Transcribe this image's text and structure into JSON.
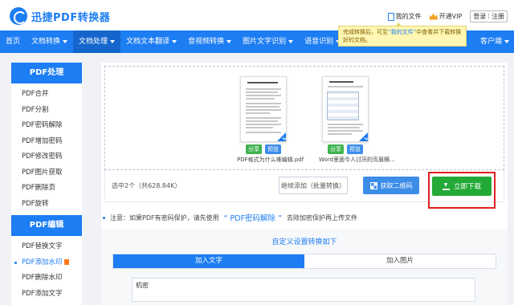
{
  "header": {
    "logo_text": "迅捷PDF转换器",
    "my_files": "我的文件",
    "vip": "开通VIP",
    "login": "登录",
    "register": "注册"
  },
  "tooltip": {
    "text_before": "完成转换后，可至",
    "highlight": "“我的文件”",
    "text_after": "中查看并下载转换好的文档。"
  },
  "nav": {
    "items": [
      {
        "label": "首页",
        "caret": false,
        "active": false
      },
      {
        "label": "文档转换",
        "caret": true,
        "active": false
      },
      {
        "label": "文档处理",
        "caret": true,
        "active": true
      },
      {
        "label": "文档文本翻译",
        "caret": true,
        "active": false
      },
      {
        "label": "音视频转换",
        "caret": true,
        "active": false
      },
      {
        "label": "图片文字识别",
        "caret": true,
        "active": false
      },
      {
        "label": "语音识别",
        "caret": true,
        "active": false
      }
    ],
    "right_label": "客户端"
  },
  "sidebar": {
    "sections": [
      {
        "title": "PDF处理",
        "items": [
          "PDF合并",
          "PDF分割",
          "PDF密码解除",
          "PDF增加密码",
          "PDF修改密码",
          "PDF图片获取",
          "PDF删除页",
          "PDF旋转"
        ]
      },
      {
        "title": "PDF编辑",
        "items": [
          "PDF替换文字",
          "PDF添加水印",
          "PDF删除水印",
          "PDF添加文字"
        ]
      }
    ],
    "active_item": "PDF添加水印"
  },
  "files": [
    {
      "name": "PDF格式为什么难编辑.pdf",
      "share": "分享",
      "preview": "预览"
    },
    {
      "name": "Word里面今人讨厌的页眉横...",
      "share": "分享",
      "preview": "预览"
    }
  ],
  "actions": {
    "selection": "选中2个（共628.84K）",
    "continue_add": "继续添加（批量转换）",
    "qr": "获取二维码",
    "download": "立即下载"
  },
  "note": {
    "prefix": "注意：如果PDF有密码保护，请先使用",
    "link": "“ PDF密码解除 ”",
    "suffix": "去除加密保护再上传文件"
  },
  "settings": {
    "title": "自定义设置转换如下",
    "tabs": [
      "加入文字",
      "加入图片"
    ],
    "active_tab": 0,
    "text_value": "机密"
  },
  "colors": {
    "brand": "#1d7df2",
    "download": "#22a936",
    "highlight_box": "#e02020"
  }
}
